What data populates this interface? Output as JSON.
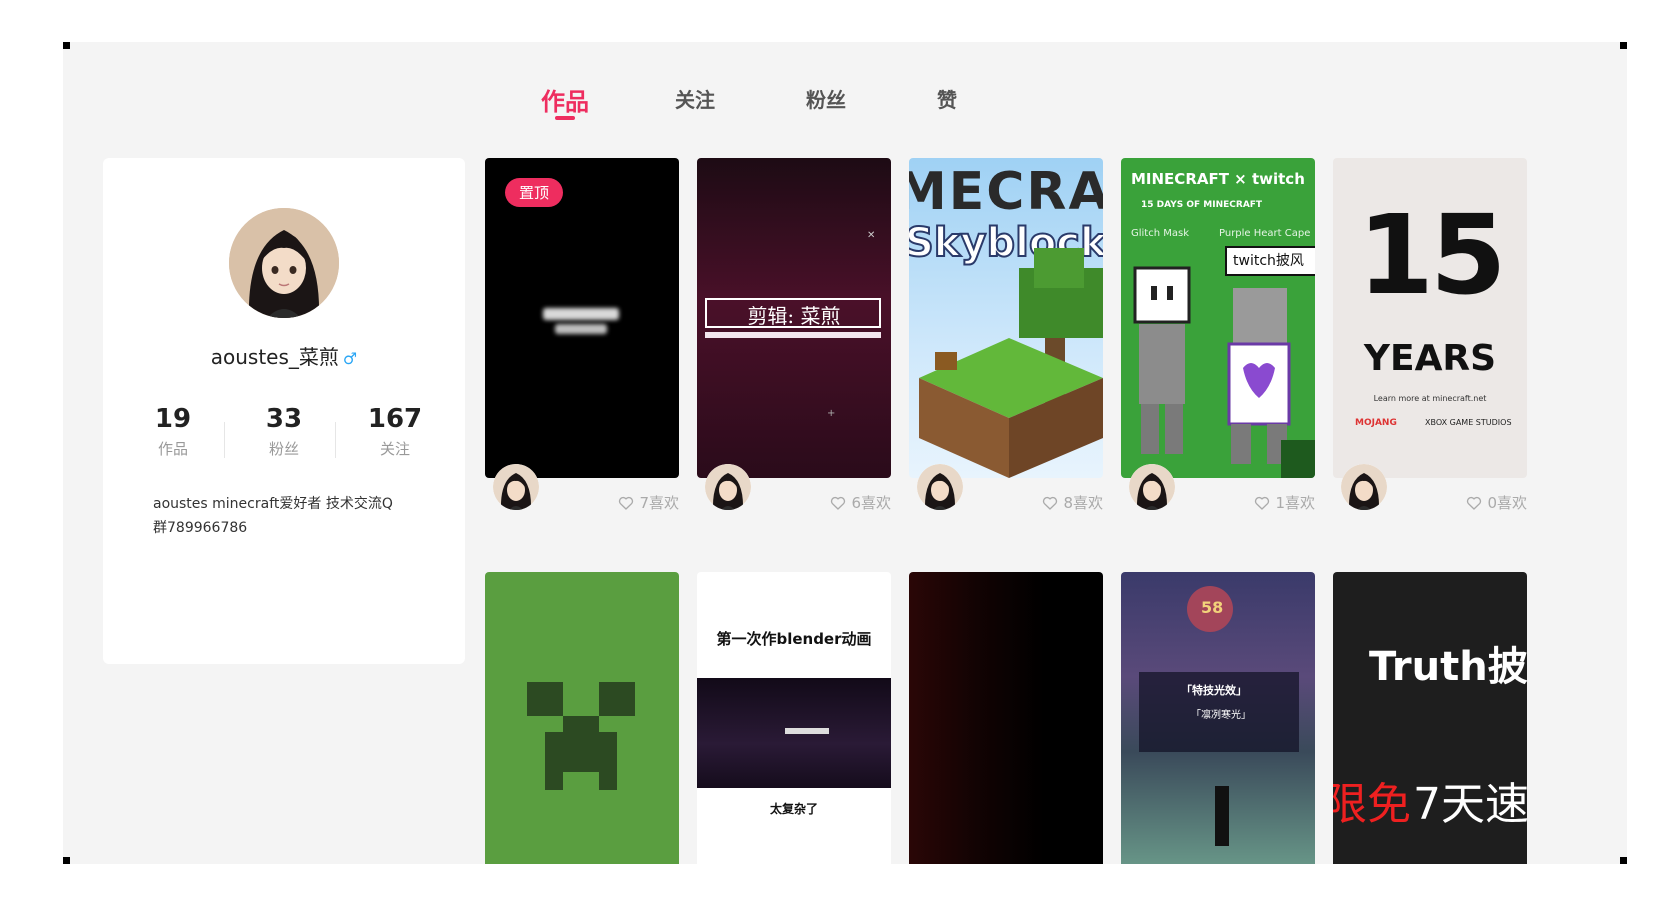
{
  "tabs": [
    {
      "label": "作品",
      "active": true
    },
    {
      "label": "关注",
      "active": false
    },
    {
      "label": "粉丝",
      "active": false
    },
    {
      "label": "赞",
      "active": false
    }
  ],
  "profile": {
    "username": "aoustes_菜煎",
    "gender_symbol": "♂",
    "stats": [
      {
        "value": "19",
        "label": "作品"
      },
      {
        "value": "33",
        "label": "粉丝"
      },
      {
        "value": "167",
        "label": "关注"
      }
    ],
    "bio_line1": "aoustes minecraft爱好者 技术交流Q",
    "bio_line2": "群789966786"
  },
  "works": [
    {
      "pinned_label": "置顶",
      "likes": "7喜欢",
      "thumb_text": ""
    },
    {
      "likes": "6喜欢",
      "thumb_text": "剪辑: 菜煎"
    },
    {
      "likes": "8喜欢",
      "thumb_text_1": "MECRA",
      "thumb_text_2": "Skyblock"
    },
    {
      "likes": "1喜欢",
      "thumb_text_1": "MINECRAFT × twitch",
      "thumb_text_2": "15 DAYS OF MINECRAFT",
      "thumb_text_3": "Glitch Mask",
      "thumb_text_4": "Purple Heart Cape",
      "thumb_text_5": "twitch披风"
    },
    {
      "likes": "0喜欢",
      "thumb_text_1": "15",
      "thumb_text_2": "YEARS",
      "thumb_text_3": "Learn more at minecraft.net",
      "thumb_text_4": "MOJANG",
      "thumb_text_5": "XBOX GAME STUDIOS"
    },
    {
      "thumb_text": ""
    },
    {
      "thumb_text_1": "第一次作blender动画",
      "thumb_text_2": "太复杂了"
    },
    {
      "thumb_text": ""
    },
    {
      "thumb_text_1": "58",
      "thumb_text_2": "「特技光效」",
      "thumb_text_3": "「凛冽寒光」"
    },
    {
      "thumb_text_1": "Truth披",
      "thumb_text_2": "限免",
      "thumb_text_3": "7天速"
    }
  ],
  "colors": {
    "accent": "#ee2d5f",
    "background": "#f4f4f4"
  }
}
